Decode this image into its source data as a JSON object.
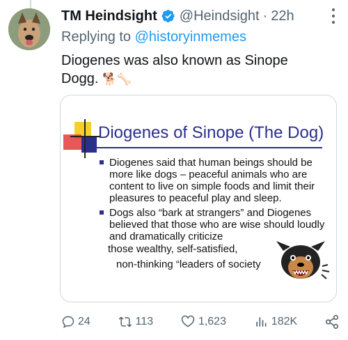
{
  "tweet": {
    "author_name": "TM Heindsight",
    "handle": "@Heindsight",
    "separator": "·",
    "time": "22h",
    "reply_prefix": "Replying to ",
    "reply_mention": "@historyinmemes",
    "text": "Diogenes was also known as Sinope Dogg.",
    "emojis": "🐕🦴"
  },
  "slide": {
    "title": "Diogenes of Sinope (The Dog)",
    "bullets": [
      "Diogenes said that human beings should be more like dogs – peaceful animals who are content to live on simple foods and limit their pleasures to peaceful play and sleep.",
      "Dogs also “bark at strangers” and Diogenes believed that those who are wise should loudly and dramatically criticize"
    ],
    "continuation_1": "those wealthy, self-satisfied,",
    "continuation_2": "non-thinking “leaders of society"
  },
  "actions": {
    "replies": "24",
    "retweets": "113",
    "likes": "1,623",
    "views": "182K"
  },
  "colors": {
    "text": "#0f1419",
    "secondary": "#536471",
    "link": "#1d9bf0",
    "slide_blue": "#2b2f8c"
  },
  "icons": [
    "verified-badge-icon",
    "more-icon",
    "reply-icon",
    "retweet-icon",
    "like-icon",
    "views-icon",
    "share-icon"
  ]
}
